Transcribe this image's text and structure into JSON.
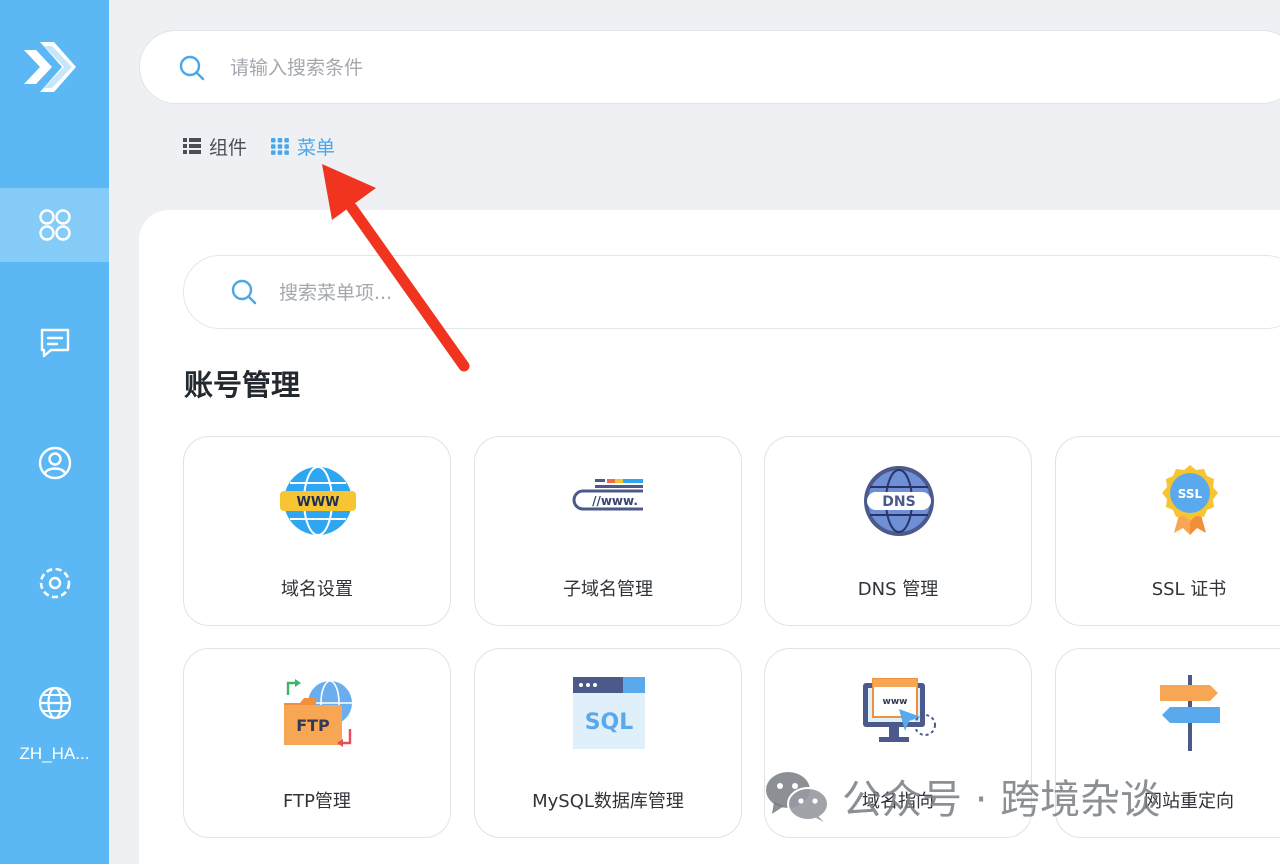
{
  "sidebar": {
    "language_label": "ZH_HA..."
  },
  "top_search": {
    "placeholder": "请输入搜索条件"
  },
  "tabs": {
    "components": "组件",
    "menu": "菜单"
  },
  "menu_search": {
    "placeholder": "搜索菜单项..."
  },
  "section": {
    "title": "账号管理"
  },
  "cards": [
    {
      "label": "域名设置",
      "icon": "www-globe-icon"
    },
    {
      "label": "子域名管理",
      "icon": "subdomain-www-icon"
    },
    {
      "label": "DNS 管理",
      "icon": "dns-globe-icon"
    },
    {
      "label": "SSL 证书",
      "icon": "ssl-badge-icon"
    },
    {
      "label": "FTP管理",
      "icon": "ftp-folder-icon"
    },
    {
      "label": "MySQL数据库管理",
      "icon": "sql-window-icon"
    },
    {
      "label": "域名指向",
      "icon": "domain-pointer-icon"
    },
    {
      "label": "网站重定向",
      "icon": "signpost-icon"
    }
  ],
  "watermark": {
    "text": "公众号 · 跨境杂谈"
  },
  "colors": {
    "sidebar": "#5bb8f4",
    "sidebar_active": "#84cbf7",
    "accent": "#4aa8e8",
    "annotation_arrow": "#f0341f"
  }
}
